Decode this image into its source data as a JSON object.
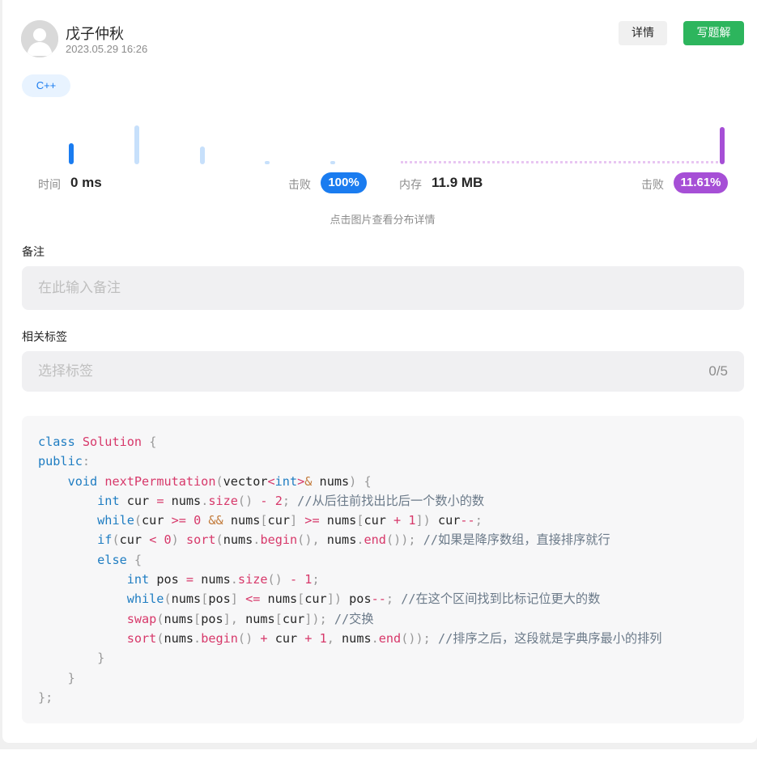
{
  "header": {
    "author": "戊子仲秋",
    "date": "2023.05.29 16:26",
    "detail_label": "详情",
    "write_label": "写题解"
  },
  "language_tag": "C++",
  "stats": {
    "time_label": "时间",
    "time_value": "0 ms",
    "time_beat_label": "击败",
    "time_beat_value": "100%",
    "memory_label": "内存",
    "memory_value": "11.9 MB",
    "memory_beat_label": "击败",
    "memory_beat_value": "11.61%",
    "hint": "点击图片查看分布详情",
    "colors": {
      "time_accent": "#1a7cf0",
      "time_light": "#c7e0fb",
      "memory_accent": "#a64fd6",
      "memory_light": "#e8c6f2"
    }
  },
  "note": {
    "label": "备注",
    "placeholder": "在此输入备注"
  },
  "tags": {
    "label": "相关标签",
    "placeholder": "选择标签",
    "count": "0/5"
  },
  "code": {
    "language": "cpp",
    "lines": [
      "class Solution {",
      "public:",
      "    void nextPermutation(vector<int>& nums) {",
      "        int cur = nums.size() - 2; //从后往前找出比后一个数小的数",
      "        while(cur >= 0 && nums[cur] >= nums[cur + 1]) cur--;",
      "        if(cur < 0) sort(nums.begin(), nums.end()); //如果是降序数组，直接排序就行",
      "        else {",
      "            int pos = nums.size() - 1;",
      "            while(nums[pos] <= nums[cur]) pos--; //在这个区间找到比标记位更大的数",
      "            swap(nums[pos], nums[cur]); //交换",
      "            sort(nums.begin() + cur + 1, nums.end()); //排序之后，这段就是字典序最小的排列",
      "        }",
      "    }",
      "};"
    ]
  }
}
